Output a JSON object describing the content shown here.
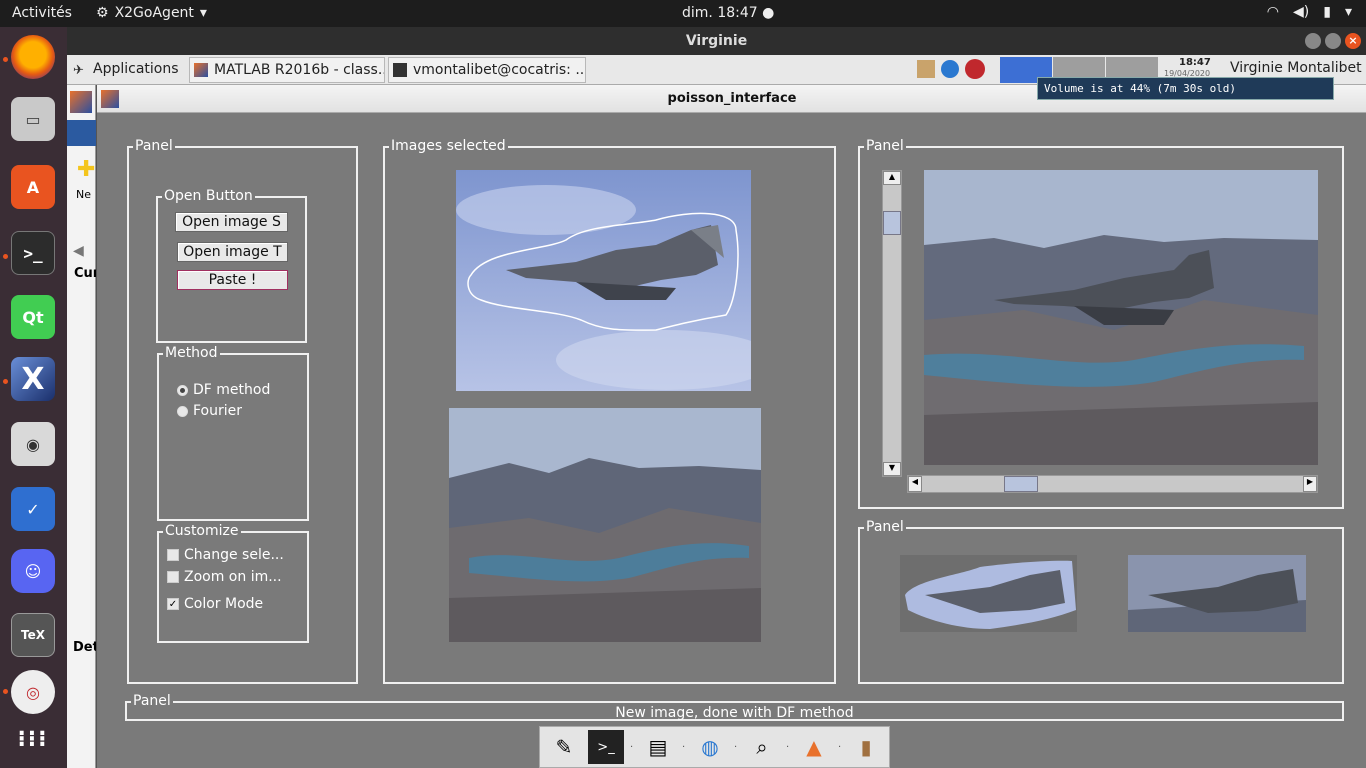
{
  "topbar": {
    "activities": "Activités",
    "app_name": "X2GoAgent",
    "clock": "dim. 18:47 ●"
  },
  "remote_window": {
    "title": "Virginie"
  },
  "remote_taskbar": {
    "applications": "Applications",
    "tasks": [
      "MATLAB R2016b - class...",
      "vmontalibet@cocatris: ..."
    ],
    "time": "18:47",
    "date": "19/04/2020",
    "user": "Virginie Montalibet"
  },
  "tooltip": "Volume is at 44% (7m 30s old)",
  "matlab_strip": {
    "new_label": "Ne",
    "cu_label": "Cur",
    "det_label": "Det"
  },
  "app": {
    "title": "poisson_interface",
    "panel_left": {
      "title": "Panel",
      "open_group_title": "Open Button",
      "btn_open_s": "Open image S",
      "btn_open_t": "Open image T",
      "btn_paste": "Paste !",
      "method_title": "Method",
      "method_options": [
        "DF method",
        "Fourier"
      ],
      "method_selected": "DF method",
      "customize_title": "Customize",
      "customize_options": [
        {
          "label": "Change sele...",
          "checked": false
        },
        {
          "label": "Zoom on im...",
          "checked": false
        },
        {
          "label": "Color Mode",
          "checked": true
        }
      ]
    },
    "panel_images": {
      "title": "Images selected"
    },
    "panel_result": {
      "title": "Panel"
    },
    "panel_thumbs": {
      "title": "Panel"
    },
    "panel_status": {
      "title": "Panel",
      "message": "New image, done with DF method"
    }
  },
  "colors": {
    "accent": "#e95420",
    "background": "#7a7a7a",
    "panel_border": "#f0f0f0"
  }
}
